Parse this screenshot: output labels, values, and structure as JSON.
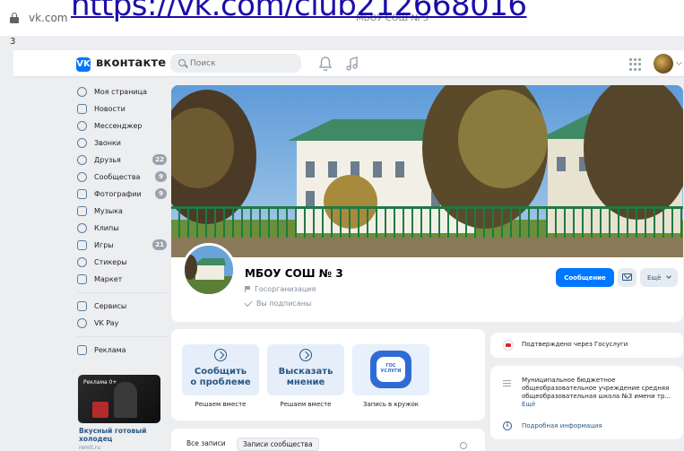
{
  "browser": {
    "domain": "vk.com",
    "tab_title": "МБОУ СОШ № 3",
    "url_overlay": "https://vk.com/club212668016",
    "gutter_text": "3"
  },
  "header": {
    "logo_text": "вконтакте",
    "search_placeholder": "Поиск"
  },
  "nav": {
    "items": [
      {
        "label": "Моя страница",
        "badge": ""
      },
      {
        "label": "Новости",
        "badge": ""
      },
      {
        "label": "Мессенджер",
        "badge": ""
      },
      {
        "label": "Звонки",
        "badge": ""
      },
      {
        "label": "Друзья",
        "badge": "22"
      },
      {
        "label": "Сообщества",
        "badge": "9"
      },
      {
        "label": "Фотографии",
        "badge": "9"
      },
      {
        "label": "Музыка",
        "badge": ""
      },
      {
        "label": "Клипы",
        "badge": ""
      },
      {
        "label": "Игры",
        "badge": "21"
      },
      {
        "label": "Стикеры",
        "badge": ""
      },
      {
        "label": "Маркет",
        "badge": ""
      }
    ],
    "secondary": [
      {
        "label": "Сервисы"
      },
      {
        "label": "VK Pay"
      }
    ],
    "ads_label": "Реклама",
    "ad": {
      "tag": "Реклама 0+",
      "title": "Вкусный готовый холодец",
      "domain": "remit.ru"
    }
  },
  "community": {
    "name": "МБОУ СОШ № 3",
    "type": "Госорганизация",
    "subscribed": "Вы подписаны",
    "message_button": "Сообщение",
    "more_button": "Ещё"
  },
  "widgets": [
    {
      "text": "Сообщить\nо проблеме",
      "caption": "Решаем вместе"
    },
    {
      "text": "Высказать\nмнение",
      "caption": "Решаем вместе"
    },
    {
      "logo": "ГОС\nУСЛУГИ",
      "caption": "Запись в кружок"
    }
  ],
  "right": {
    "verified": "Подтверждено через Госуслуги",
    "description": "Муниципальное бюджетное общеобразовательное учреждение средняя общеобразовательная школа №3 имени тр...",
    "description_more": "Ещё",
    "details_link": "Подробная информация"
  },
  "wall": {
    "tabs": [
      "Все записи",
      "Записи сообщества"
    ]
  },
  "colors": {
    "accent": "#0077ff",
    "link": "#2a5885",
    "background": "#edeef0"
  }
}
